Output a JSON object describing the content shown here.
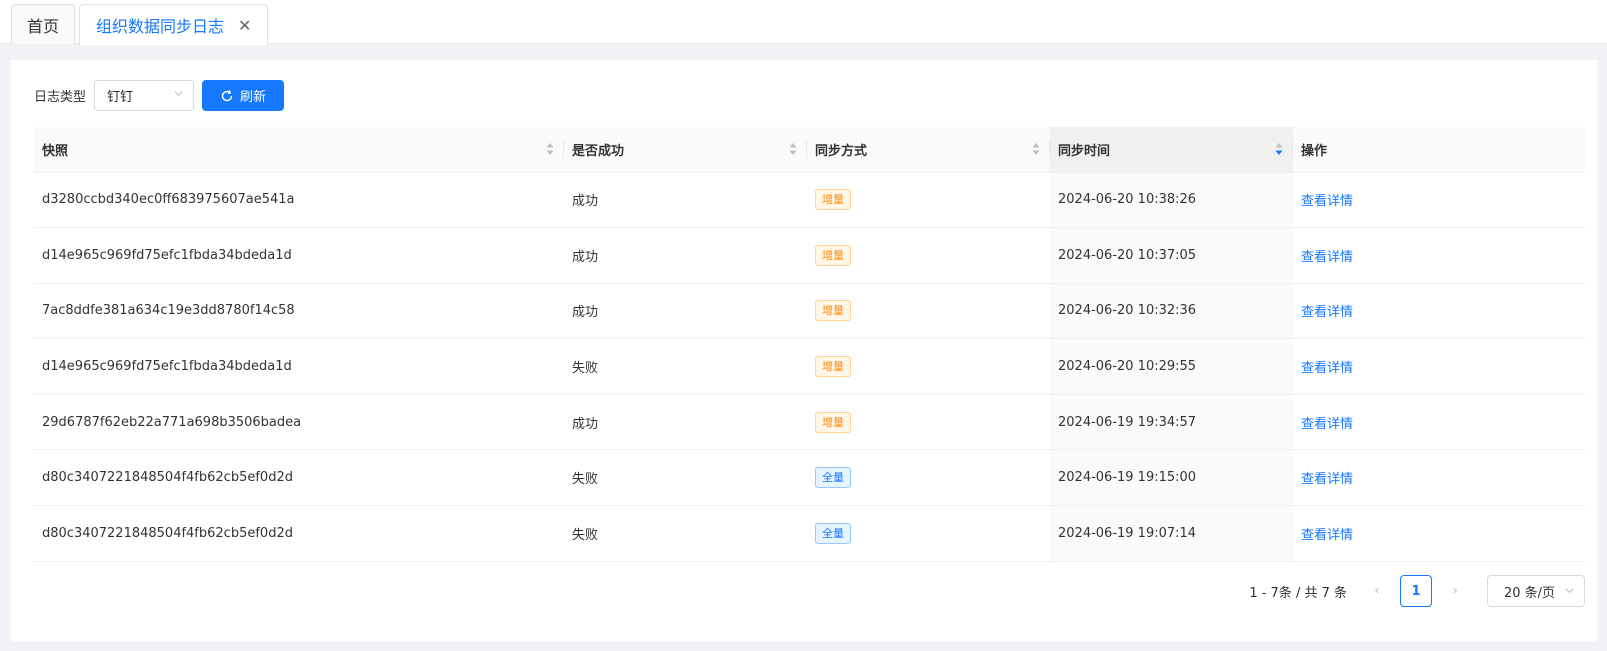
{
  "tabs": [
    {
      "label": "首页"
    },
    {
      "label": "组织数据同步日志"
    }
  ],
  "toolbar": {
    "log_type_label": "日志类型",
    "log_type_value": "钉钉",
    "refresh_label": "刷新"
  },
  "table": {
    "headers": {
      "snapshot": "快照",
      "success": "是否成功",
      "method": "同步方式",
      "time": "同步时间",
      "action": "操作"
    },
    "rows": [
      {
        "snapshot": "d3280ccbd340ec0ff683975607ae541a",
        "success": "成功",
        "method": "增量",
        "time": "2024-06-20 10:38:26",
        "action": "查看详情"
      },
      {
        "snapshot": "d14e965c969fd75efc1fbda34bdeda1d",
        "success": "成功",
        "method": "增量",
        "time": "2024-06-20 10:37:05",
        "action": "查看详情"
      },
      {
        "snapshot": "7ac8ddfe381a634c19e3dd8780f14c58",
        "success": "成功",
        "method": "增量",
        "time": "2024-06-20 10:32:36",
        "action": "查看详情"
      },
      {
        "snapshot": "d14e965c969fd75efc1fbda34bdeda1d",
        "success": "失败",
        "method": "增量",
        "time": "2024-06-20 10:29:55",
        "action": "查看详情"
      },
      {
        "snapshot": "29d6787f62eb22a771a698b3506badea",
        "success": "成功",
        "method": "增量",
        "time": "2024-06-19 19:34:57",
        "action": "查看详情"
      },
      {
        "snapshot": "d80c3407221848504f4fb62cb5ef0d2d",
        "success": "失败",
        "method": "全量",
        "time": "2024-06-19 19:15:00",
        "action": "查看详情"
      },
      {
        "snapshot": "d80c3407221848504f4fb62cb5ef0d2d",
        "success": "失败",
        "method": "全量",
        "time": "2024-06-19 19:07:14",
        "action": "查看详情"
      }
    ]
  },
  "pagination": {
    "total_text": "1 - 7条 / 共 7 条",
    "current_page": "1",
    "page_size": "20 条/页"
  },
  "colors": {
    "accent": "#1677ff",
    "tag_incremental": "#fa8c16",
    "tag_full": "#1677ff"
  }
}
